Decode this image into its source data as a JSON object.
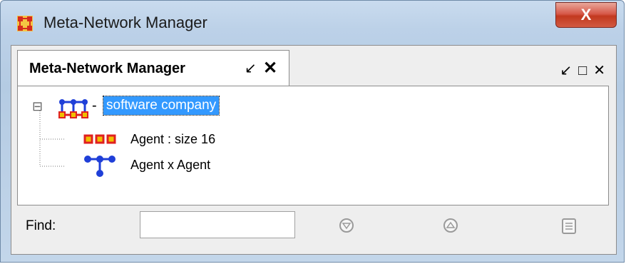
{
  "window": {
    "title": "Meta-Network Manager",
    "close_symbol": "X"
  },
  "tab": {
    "label": "Meta-Network Manager",
    "restore_symbol": "↙",
    "close_symbol": "✕"
  },
  "panel_controls": {
    "restore_symbol": "↙",
    "maximize_symbol": "□",
    "close_symbol": "✕"
  },
  "tree": {
    "root": {
      "label": "software company",
      "expander": "⊟",
      "separator": "-"
    },
    "children": [
      {
        "label": "Agent : size 16",
        "icon": "agent-nodeset-icon"
      },
      {
        "label": "Agent x Agent",
        "icon": "network-graph-icon"
      }
    ]
  },
  "find": {
    "label": "Find:",
    "value": ""
  },
  "buttons": [
    {
      "name": "find-next-button",
      "icon": "down-arrow-circle-icon"
    },
    {
      "name": "find-previous-button",
      "icon": "up-arrow-circle-icon"
    },
    {
      "name": "find-list-button",
      "icon": "list-icon"
    }
  ],
  "colors": {
    "selection": "#3399ff",
    "node_red": "#e02020",
    "node_blue": "#1f3fd8",
    "node_yellow": "#f0c000"
  }
}
